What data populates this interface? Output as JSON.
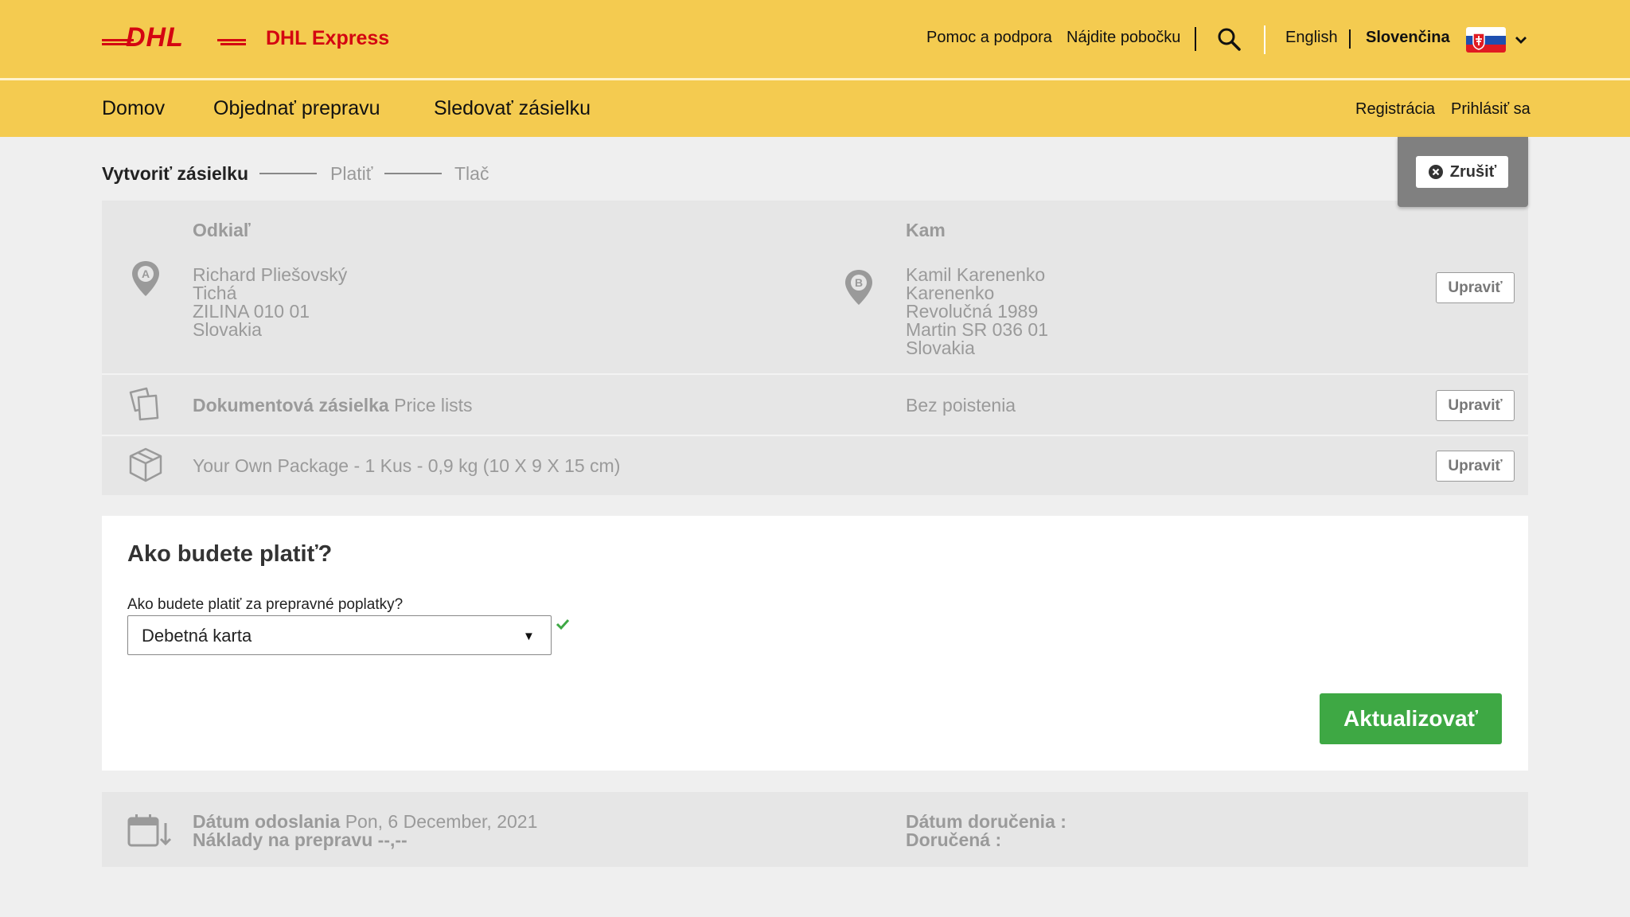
{
  "brand": {
    "logo_text": "DHL",
    "name": "DHL Express"
  },
  "utility_nav": {
    "help": "Pomoc a podpora",
    "find_location": "Nájdite pobočku",
    "lang_en": "English",
    "lang_sk": "Slovenčina"
  },
  "main_nav": {
    "home": "Domov",
    "order": "Objednať prepravu",
    "track": "Sledovať zásielku",
    "register": "Registrácia",
    "login": "Prihlásiť sa"
  },
  "steps": [
    {
      "label": "Vytvoriť zásielku",
      "active": true
    },
    {
      "label": "Platiť",
      "active": false
    },
    {
      "label": "Tlač",
      "active": false
    }
  ],
  "cancel_label": "Zrušiť",
  "summary": {
    "from_title": "Odkiaľ",
    "to_title": "Kam",
    "from_address": [
      "Richard Pliešovský",
      "Tichá",
      "ZILINA 010 01",
      "Slovakia"
    ],
    "to_address": [
      "Kamil Karenenko",
      "Karenenko",
      "Revolučná 1989",
      "Martin SR 036 01",
      "Slovakia"
    ],
    "shipment_type_bold": "Dokumentová zásielka",
    "shipment_type_desc": "Price lists",
    "insurance": "Bez poistenia",
    "package": "Your Own Package - 1 Kus - 0,9 kg (10 X 9 X 15 cm)",
    "edit_label": "Upraviť"
  },
  "payment": {
    "title": "Ako budete platiť?",
    "question": "Ako budete platiť za prepravné poplatky?",
    "selected": "Debetná karta",
    "update_label": "Aktualizovať"
  },
  "dates": {
    "ship_date_label": "Dátum odoslania",
    "ship_date_value": "Pon, 6 December, 2021",
    "cost_label": "Náklady na prepravu",
    "cost_value": "--,--",
    "delivery_date_label": "Dátum doručenia :",
    "delivered_label": "Doručená :"
  },
  "colors": {
    "header_yellow": "#f4cb50",
    "dhl_red": "#d40511",
    "update_green": "#3ea844"
  },
  "icons": [
    "dhl-logo",
    "search-icon",
    "slovak-flag-icon",
    "chevron-down-icon",
    "close-circle-icon",
    "pin-a-icon",
    "pin-b-icon",
    "documents-icon",
    "package-icon",
    "check-icon",
    "calendar-icon"
  ]
}
